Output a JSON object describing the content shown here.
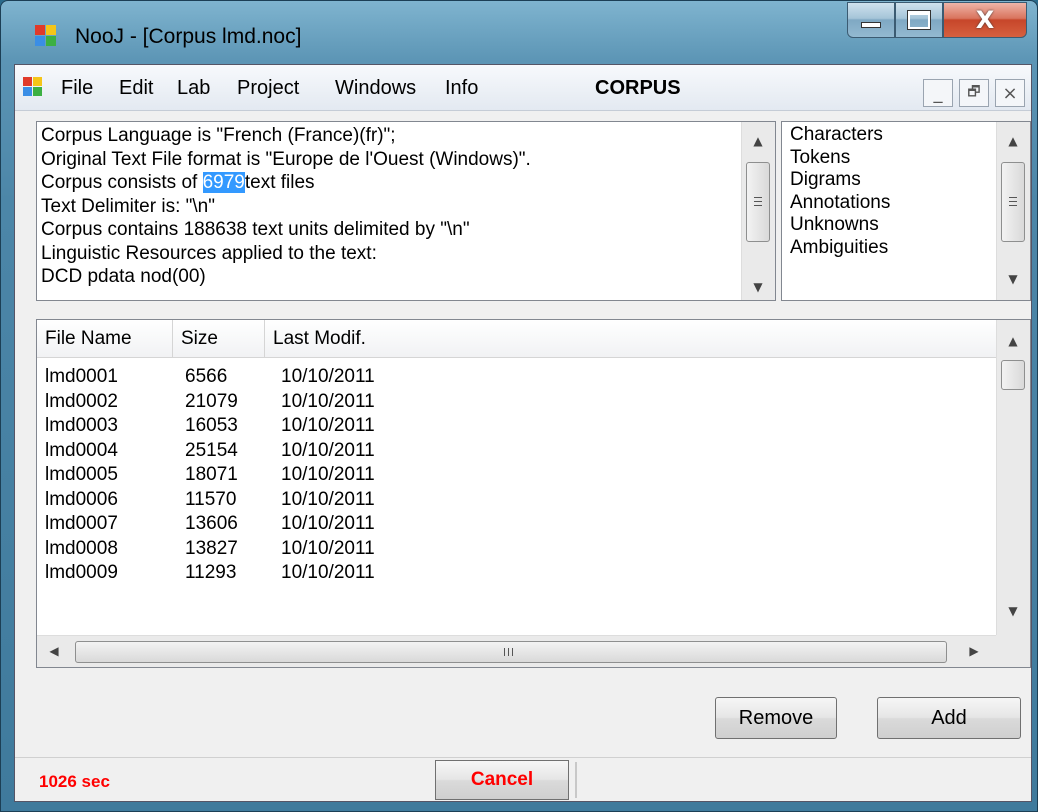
{
  "window": {
    "title": "NooJ - [Corpus lmd.noc]",
    "caption": {
      "minimize": "minimize",
      "maximize": "maximize",
      "close": "X"
    }
  },
  "menu": {
    "items": [
      "File",
      "Edit",
      "Lab",
      "Project",
      "Windows",
      "Info"
    ],
    "context": "CORPUS",
    "mdi": {
      "minimize": "_",
      "restore": "🗗",
      "close": "×"
    }
  },
  "info": {
    "lines": [
      "Corpus Language is \"French (France)(fr)\";",
      "Original Text File format is \"Europe de l'Ouest (Windows)\".",
      "Text Delimiter is: \"\\n\"",
      "Corpus contains 188638 text units delimited by \"\\n\"",
      "Linguistic Resources applied to the text:",
      "DCD pdata nod(00)"
    ],
    "files_prefix": "Corpus consists of ",
    "files_count": "6979",
    "files_suffix": "text files"
  },
  "stats": {
    "items": [
      "Characters",
      "Tokens",
      "Digrams",
      "Annotations",
      "Unknowns",
      "Ambiguities"
    ]
  },
  "files": {
    "columns": [
      "File Name",
      "Size",
      "Last Modif."
    ],
    "rows": [
      [
        "lmd0001",
        "6566",
        "10/10/2011"
      ],
      [
        "lmd0002",
        "21079",
        "10/10/2011"
      ],
      [
        "lmd0003",
        "16053",
        "10/10/2011"
      ],
      [
        "lmd0004",
        "25154",
        "10/10/2011"
      ],
      [
        "lmd0005",
        "18071",
        "10/10/2011"
      ],
      [
        "lmd0006",
        "11570",
        "10/10/2011"
      ],
      [
        "lmd0007",
        "13606",
        "10/10/2011"
      ],
      [
        "lmd0008",
        "13827",
        "10/10/2011"
      ],
      [
        "lmd0009",
        "11293",
        "10/10/2011"
      ]
    ]
  },
  "buttons": {
    "remove": "Remove",
    "add": "Add",
    "cancel": "Cancel"
  },
  "status": {
    "elapsed": "1026 sec"
  },
  "colors": {
    "selection": "#3399ff",
    "status_red": "#ff0000"
  }
}
